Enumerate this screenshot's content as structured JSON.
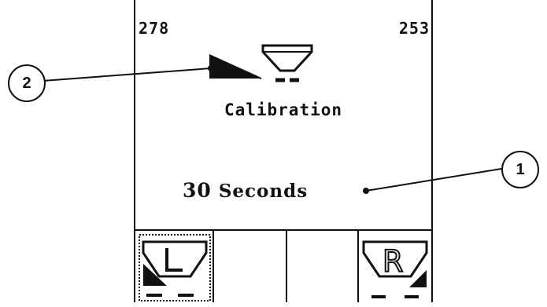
{
  "display": {
    "left_value": "278",
    "right_value": "253",
    "title": "Calibration",
    "timer_number": "30",
    "timer_unit": "Seconds"
  },
  "icons": {
    "ramp": "ramp-icon",
    "hopper": "hopper-icon",
    "left_spreader": "left-spreader-L-icon",
    "right_spreader": "right-spreader-R-icon"
  },
  "callouts": {
    "one": "1",
    "two": "2"
  }
}
